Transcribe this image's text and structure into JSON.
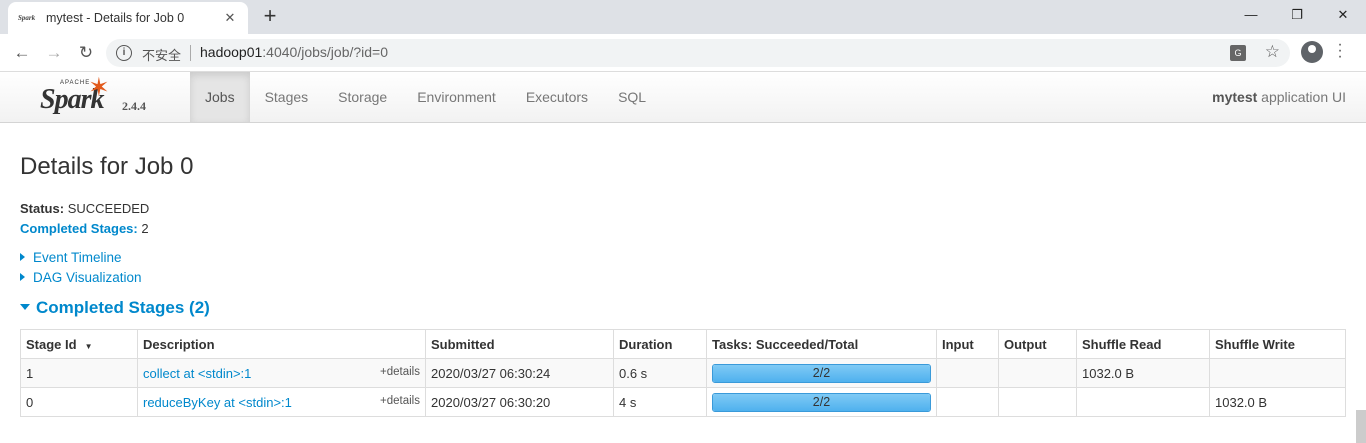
{
  "browser": {
    "tab_favicon": "Spark",
    "tab_title": "mytest - Details for Job 0",
    "tab_close": "✕",
    "new_tab": "+",
    "window_controls": {
      "minimize": "—",
      "restore": "❐",
      "close": "✕"
    },
    "omnibox": {
      "insecure_label": "不安全",
      "host": "hadoop01",
      "path": ":4040/jobs/job/?id=0"
    }
  },
  "navbar": {
    "brand_apache": "APACHE",
    "brand_name": "Spark",
    "version": "2.4.4",
    "tabs": [
      "Jobs",
      "Stages",
      "Storage",
      "Environment",
      "Executors",
      "SQL"
    ],
    "active_tab": "Jobs",
    "app_name": "mytest",
    "app_suffix": " application UI"
  },
  "page": {
    "title": "Details for Job 0",
    "status_label": "Status:",
    "status_value": "SUCCEEDED",
    "completed_label": "Completed Stages:",
    "completed_value": "2",
    "event_timeline": "Event Timeline",
    "dag_visualization": "DAG Visualization",
    "section_title": "Completed Stages (2)"
  },
  "table": {
    "headers": [
      "Stage Id",
      "Description",
      "Submitted",
      "Duration",
      "Tasks: Succeeded/Total",
      "Input",
      "Output",
      "Shuffle Read",
      "Shuffle Write"
    ],
    "sort_caret": "▼",
    "rows": [
      {
        "stage_id": "1",
        "description": "collect at <stdin>:1",
        "details": "+details",
        "submitted": "2020/03/27 06:30:24",
        "duration": "0.6 s",
        "tasks_text": "2/2",
        "tasks_fraction": 1.0,
        "input": "",
        "output": "",
        "shuffle_read": "1032.0 B",
        "shuffle_write": ""
      },
      {
        "stage_id": "0",
        "description": "reduceByKey at <stdin>:1",
        "details": "+details",
        "submitted": "2020/03/27 06:30:20",
        "duration": "4 s",
        "tasks_text": "2/2",
        "tasks_fraction": 1.0,
        "input": "",
        "output": "",
        "shuffle_read": "",
        "shuffle_write": "1032.0 B"
      }
    ]
  },
  "colors": {
    "link": "#0088cc",
    "spark_orange": "#e25a1c",
    "progress_fill": "#4fb1ee"
  }
}
